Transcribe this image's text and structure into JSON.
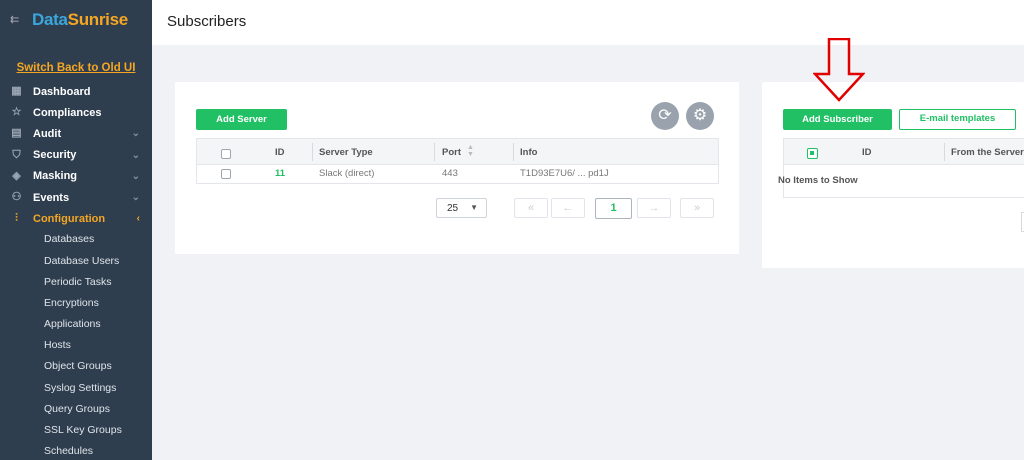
{
  "brand": {
    "part1": "Data",
    "part2": "Sunrise"
  },
  "switch_link": "Switch Back to Old UI",
  "nav": [
    {
      "label": "Dashboard",
      "icon": "dashboard-icon",
      "glyph": "▦",
      "chevron": ""
    },
    {
      "label": "Compliances",
      "icon": "star-icon",
      "glyph": "☆",
      "chevron": ""
    },
    {
      "label": "Audit",
      "icon": "audit-icon",
      "glyph": "▤",
      "chevron": "⌄"
    },
    {
      "label": "Security",
      "icon": "shield-icon",
      "glyph": "⛉",
      "chevron": "⌄"
    },
    {
      "label": "Masking",
      "icon": "masking-icon",
      "glyph": "◈",
      "chevron": "⌄"
    },
    {
      "label": "Events",
      "icon": "binoculars-icon",
      "glyph": "⚇",
      "chevron": "⌄"
    },
    {
      "label": "Configuration",
      "icon": "sliders-icon",
      "glyph": "⫶",
      "chevron": "‹",
      "active": true
    }
  ],
  "config_items": [
    "Databases",
    "Database Users",
    "Periodic Tasks",
    "Encryptions",
    "Applications",
    "Hosts",
    "Object Groups",
    "Syslog Settings",
    "Query Groups",
    "SSL Key Groups",
    "Schedules"
  ],
  "page_title": "Subscribers",
  "servers": {
    "add_button": "Add Server",
    "columns": [
      "ID",
      "Server Type",
      "Port",
      "Info"
    ],
    "rows": [
      {
        "id": "11",
        "type": "Slack (direct)",
        "port": "443",
        "info": "T1D93E7U6/ ... pd1J"
      }
    ],
    "page_size": "25",
    "current_page": "1"
  },
  "subscribers": {
    "add_button": "Add Subscriber",
    "templates_button": "E-mail templates",
    "columns": [
      "ID",
      "From the Server"
    ],
    "empty_text": "No Items to Show"
  },
  "colors": {
    "sidebar": "#2f3e4e",
    "accent_orange": "#f5a623",
    "accent_green": "#21c064",
    "annotation_red": "#e00000"
  }
}
